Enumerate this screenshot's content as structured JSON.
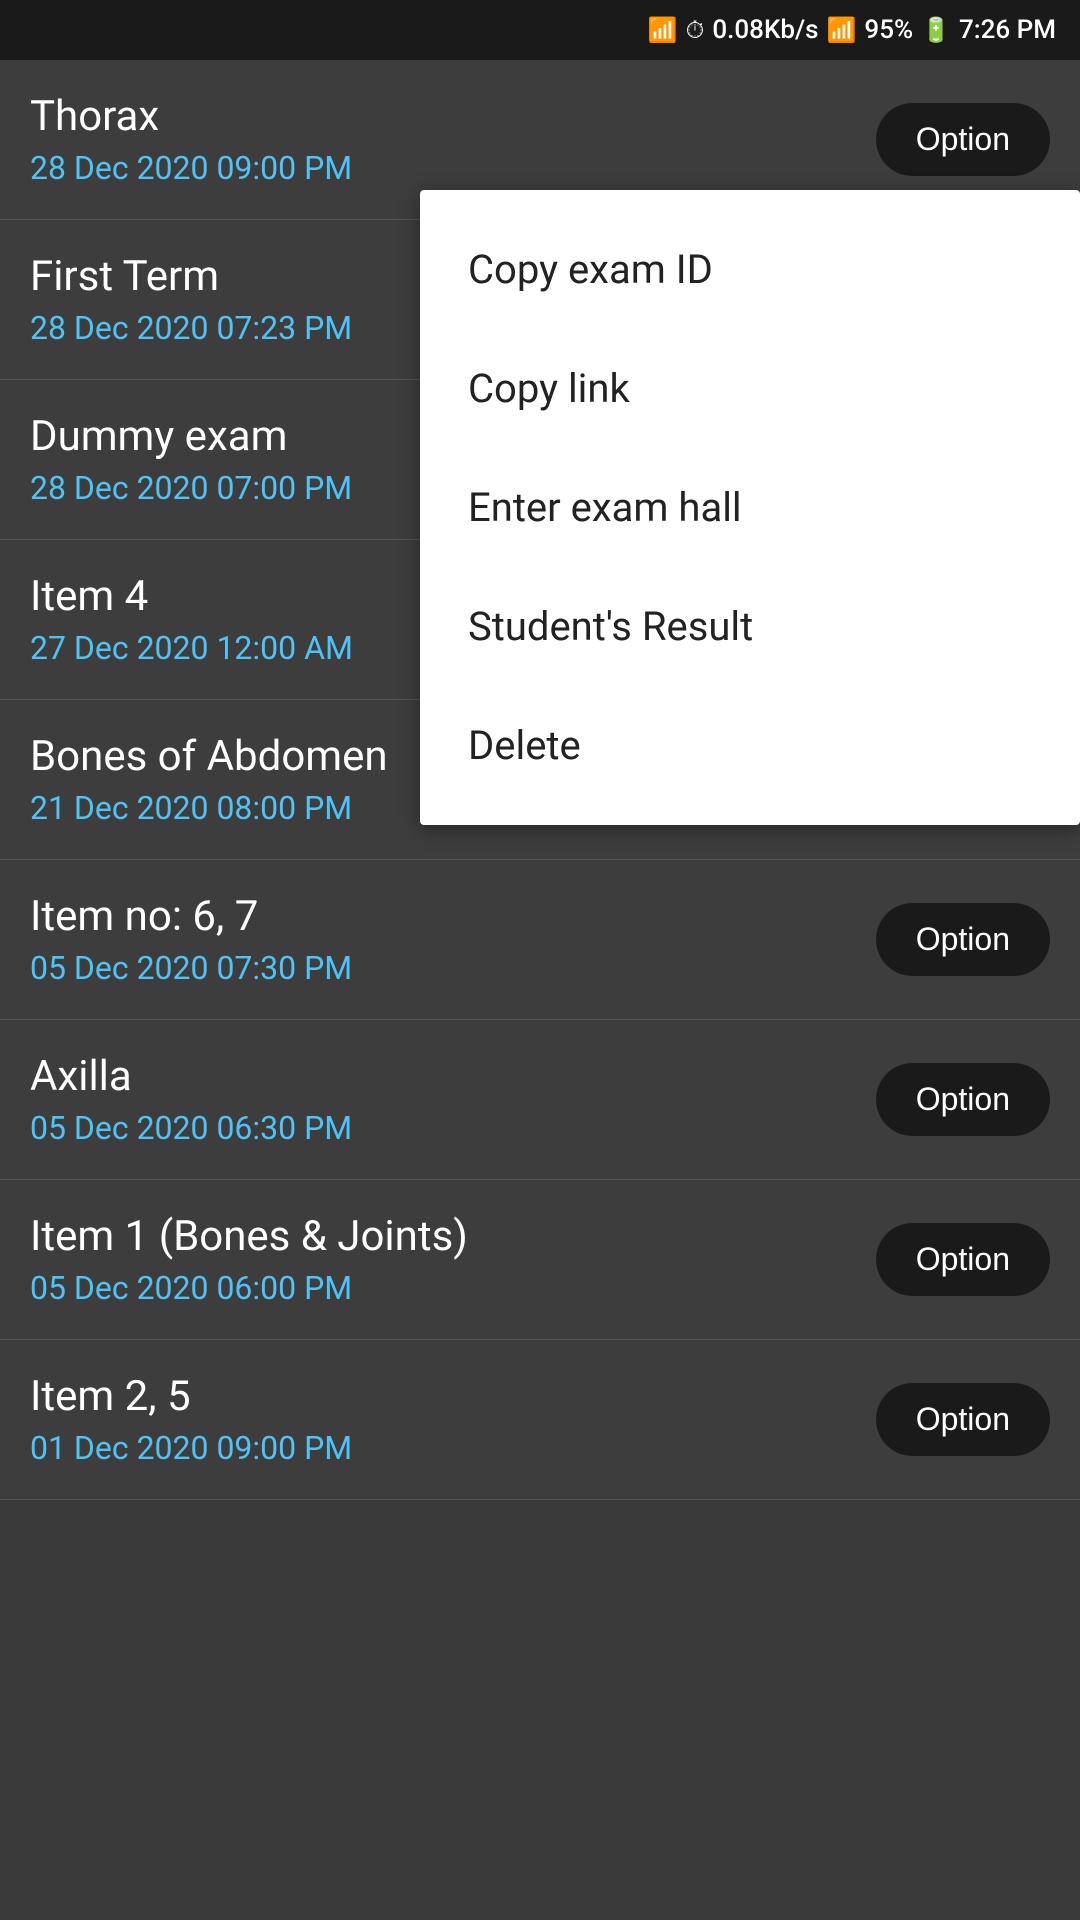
{
  "statusBar": {
    "speed": "0.08Kb/s",
    "battery": "95%",
    "time": "7:26 PM"
  },
  "examList": [
    {
      "id": "exam-1",
      "title": "Thorax",
      "date": "28 Dec 2020 09:00 PM",
      "showOption": true,
      "optionLabel": "Option"
    },
    {
      "id": "exam-2",
      "title": "First Term",
      "date": "28 Dec 2020 07:23 PM",
      "showOption": false,
      "optionLabel": "Option"
    },
    {
      "id": "exam-3",
      "title": "Dummy exam",
      "date": "28 Dec 2020 07:00 PM",
      "showOption": false,
      "optionLabel": "Option"
    },
    {
      "id": "exam-4",
      "title": "Item 4",
      "date": "27 Dec 2020 12:00 AM",
      "showOption": false,
      "optionLabel": "Option"
    },
    {
      "id": "exam-5",
      "title": "Bones of Abdomen",
      "date": "21 Dec 2020 08:00 PM",
      "showOption": true,
      "optionLabel": "Option"
    },
    {
      "id": "exam-6",
      "title": "Item no: 6, 7",
      "date": "05 Dec 2020 07:30 PM",
      "showOption": true,
      "optionLabel": "Option"
    },
    {
      "id": "exam-7",
      "title": "Axilla",
      "date": "05 Dec 2020 06:30 PM",
      "showOption": true,
      "optionLabel": "Option"
    },
    {
      "id": "exam-8",
      "title": "Item 1 (Bones & Joints)",
      "date": "05 Dec 2020 06:00 PM",
      "showOption": true,
      "optionLabel": "Option"
    },
    {
      "id": "exam-9",
      "title": "Item 2, 5",
      "date": "01 Dec 2020 09:00 PM",
      "showOption": true,
      "optionLabel": "Option"
    }
  ],
  "dropdown": {
    "items": [
      {
        "id": "copy-exam-id",
        "label": "Copy exam ID"
      },
      {
        "id": "copy-link",
        "label": "Copy link"
      },
      {
        "id": "enter-exam-hall",
        "label": "Enter exam hall"
      },
      {
        "id": "students-result",
        "label": "Student's Result"
      },
      {
        "id": "delete",
        "label": "Delete"
      }
    ]
  }
}
